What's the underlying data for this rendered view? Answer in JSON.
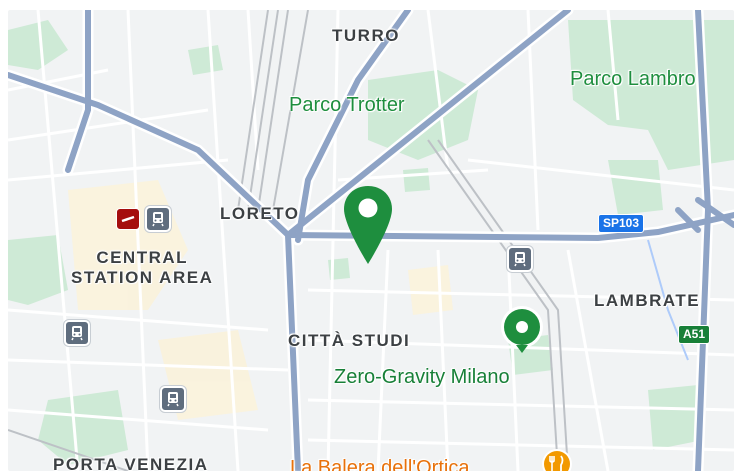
{
  "map": {
    "labels": {
      "turro": "TURRO",
      "parco_trotter": "Parco Trotter",
      "parco_lambro": "Parco Lambro",
      "loreto": "LORETO",
      "central_station_area": "CENTRAL\nSTATION AREA",
      "lambrate": "LAMBRATE",
      "citta_studi": "CITTÀ STUDI",
      "zero_gravity": "Zero-Gravity Milano",
      "porta_venezia": "PORTA VENEZIA",
      "la_balera": "La Balera dell'Ortica"
    },
    "road_shields": {
      "sp103": "SP103",
      "a51": "A51"
    },
    "colors": {
      "land": "#f1f3f4",
      "park": "#ceead6",
      "major_road": "#8ea3c5",
      "minor_road": "#ffffff",
      "rail": "#bdc1c6",
      "pin": "#1e8e3e",
      "food_pin": "#f29900",
      "transit": "#5f6d7e",
      "shield_blue": "#1a73e8",
      "shield_green": "#188038",
      "water": "#aecbfa"
    },
    "icons": {
      "selected_pin": "map-pin-icon",
      "poi_pin": "green-place-icon",
      "train": "train-station-icon",
      "rail_ticket": "rail-ticket-icon",
      "food": "restaurant-icon"
    }
  }
}
